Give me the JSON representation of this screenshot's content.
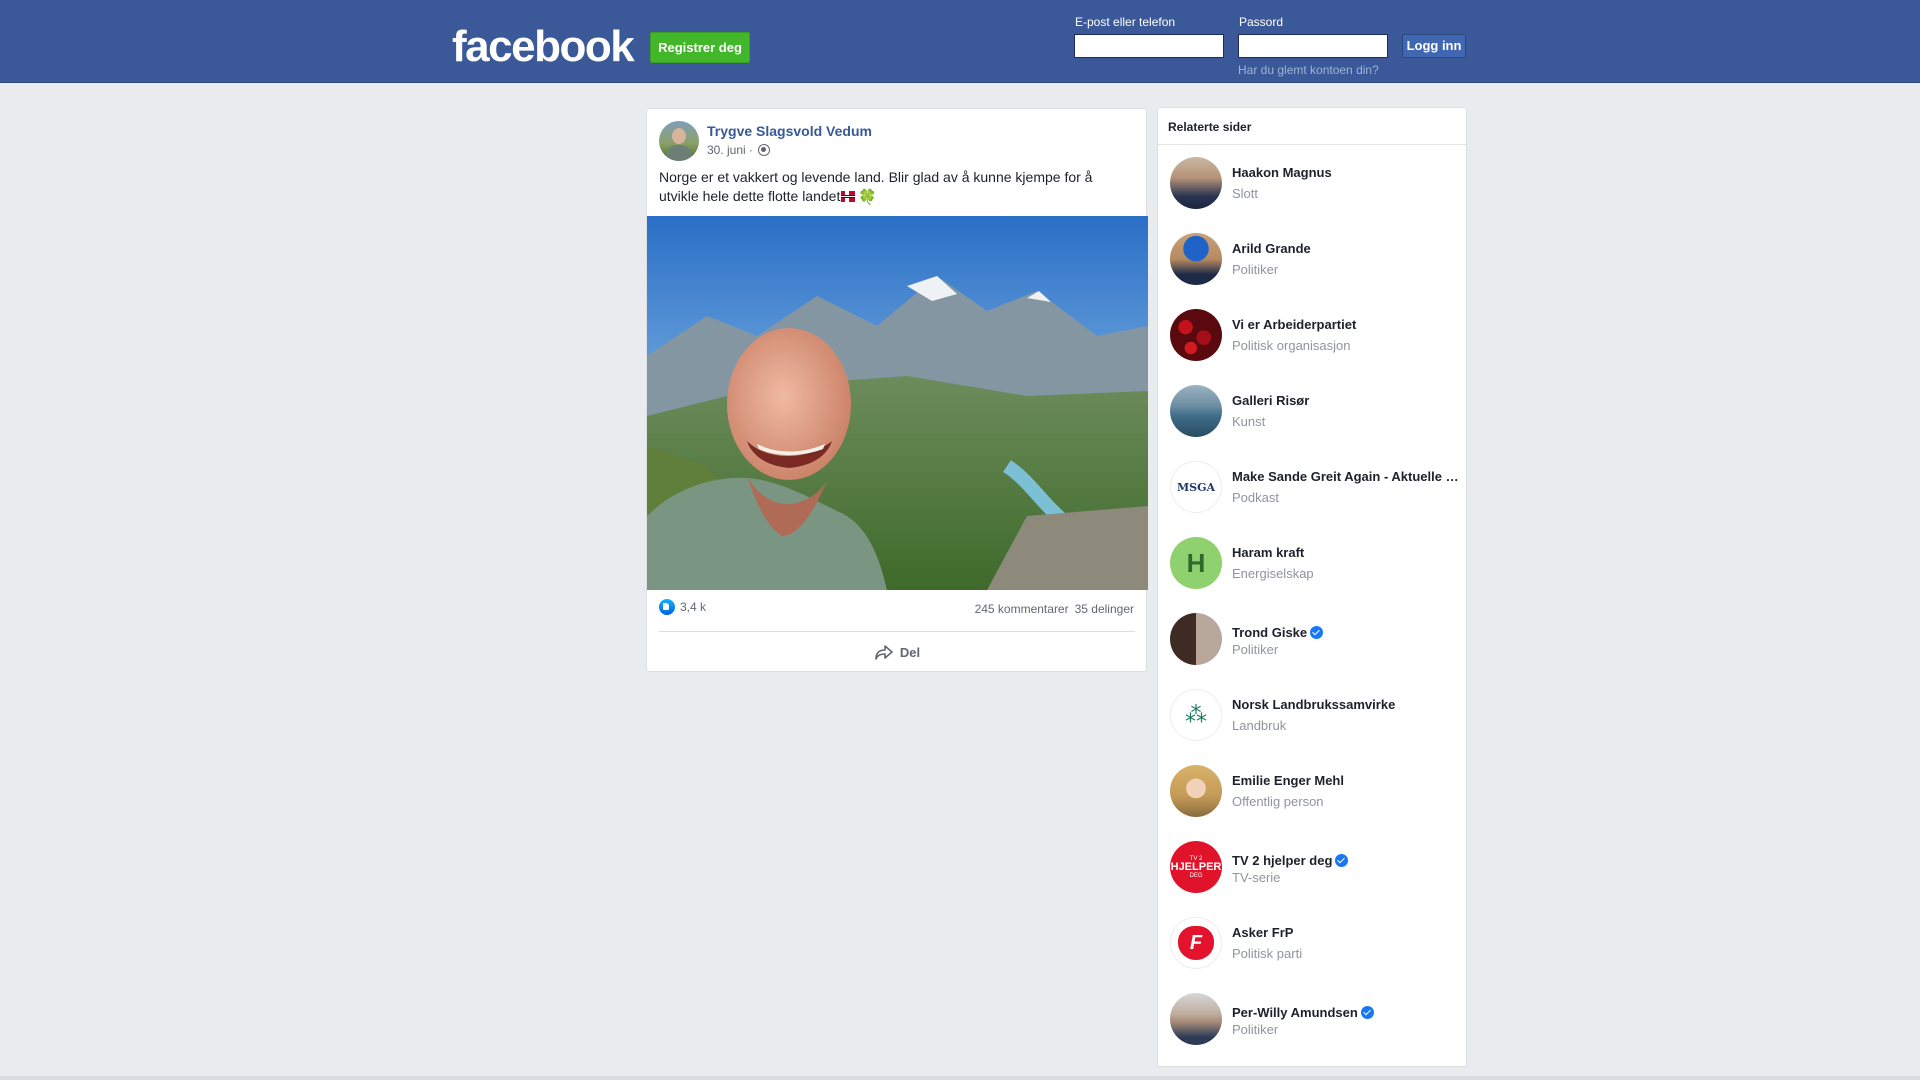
{
  "header": {
    "logo": "facebook",
    "register_button": "Registrer deg",
    "email_label": "E-post eller telefon",
    "password_label": "Passord",
    "login_button": "Logg inn",
    "forgot_link": "Har du glemt kontoen din?"
  },
  "post": {
    "author": "Trygve Slagsvold Vedum",
    "date": "30. juni",
    "date_separator": "·",
    "text": "Norge er et vakkert og levende land. Blir glad av å kunne kjempe for å utvikle hele dette flotte landet",
    "clover": "🍀",
    "likes": "3,4 k",
    "comments": "245 kommentarer",
    "shares": "35 delinger",
    "share_label": "Del"
  },
  "related": {
    "title": "Relaterte sider",
    "items": [
      {
        "name": "Haakon Magnus",
        "category": "Slott"
      },
      {
        "name": "Arild Grande",
        "category": "Politiker"
      },
      {
        "name": "Vi er Arbeiderpartiet",
        "category": "Politisk organisasjon"
      },
      {
        "name": "Galleri Risør",
        "category": "Kunst"
      },
      {
        "name": "Make Sande Greit Again - Aktuelle saker fra Sande",
        "category": "Podkast",
        "avatar_text": "MSGA"
      },
      {
        "name": "Haram kraft",
        "category": "Energiselskap",
        "avatar_text": "H"
      },
      {
        "name": "Trond Giske",
        "category": "Politiker",
        "verified": true
      },
      {
        "name": "Norsk Landbrukssamvirke",
        "category": "Landbruk"
      },
      {
        "name": "Emilie Enger Mehl",
        "category": "Offentlig person"
      },
      {
        "name": "TV 2 hjelper deg",
        "category": "TV-serie",
        "verified": true,
        "avatar_text": [
          "TV 2",
          "HJELPER",
          "DEG"
        ]
      },
      {
        "name": "Asker FrP",
        "category": "Politisk parti",
        "avatar_text": "F"
      },
      {
        "name": "Per-Willy Amundsen",
        "category": "Politiker",
        "verified": true
      }
    ]
  },
  "colors": {
    "header_bg": "#3b5998",
    "register_green": "#42b72a",
    "link_blue": "#385898",
    "verified_blue": "#1877f2"
  }
}
